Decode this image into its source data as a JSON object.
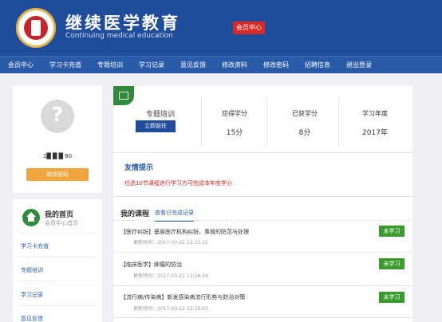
{
  "header": {
    "title": "继续医学教育",
    "subtitle": "Continuing medical education",
    "member_button": "会员中心"
  },
  "nav": {
    "items": [
      "会员中心",
      "学习卡充值",
      "专题培训",
      "学习记录",
      "意见反馈",
      "修改资料",
      "修改密码",
      "招聘信息",
      "退出登录"
    ]
  },
  "profile": {
    "phone": "1█ █ █ 80",
    "change_password": "修改密码"
  },
  "side_menu": {
    "home_title": "我的首页",
    "home_subtitle": "会员中心首页",
    "links": [
      "学习卡充值",
      "专题培训",
      "学习记录",
      "意见反馈"
    ]
  },
  "summary": {
    "course_label": "专题培训",
    "learn_button": "立即前往",
    "stats": [
      {
        "label": "应得学分",
        "value": "15分"
      },
      {
        "label": "已获学分",
        "value": "8分"
      },
      {
        "label": "学习年度",
        "value": "2017年"
      }
    ]
  },
  "tips": {
    "title": "友情提示",
    "text": "任选10节课程进行学习方可完成本年度学分"
  },
  "my_courses": {
    "title": "我的课程",
    "completed_link": "查看已完成记录",
    "courses": [
      {
        "name": "【医疗纠纷】基层医疗机构纠纷、事故的防范与处理",
        "time": "更新时间：2017-03-22 12:33:25",
        "status": "未学习"
      },
      {
        "name": "【临床医学】肿瘤的防治",
        "time": "更新时间：2017-03-22 12:28:34",
        "status": "未学习"
      },
      {
        "name": "【流行病/传染病】新发感染病流行形势与防治对策",
        "time": "更新时间：2017-03-22 12:18:03",
        "status": "未学习"
      }
    ]
  },
  "colors": {
    "brand_blue": "#1f4d9c",
    "nav_blue": "#2a5ba8",
    "accent_red": "#d82a28",
    "button_green": "#3a9a2e",
    "button_orange": "#f0a63c"
  }
}
